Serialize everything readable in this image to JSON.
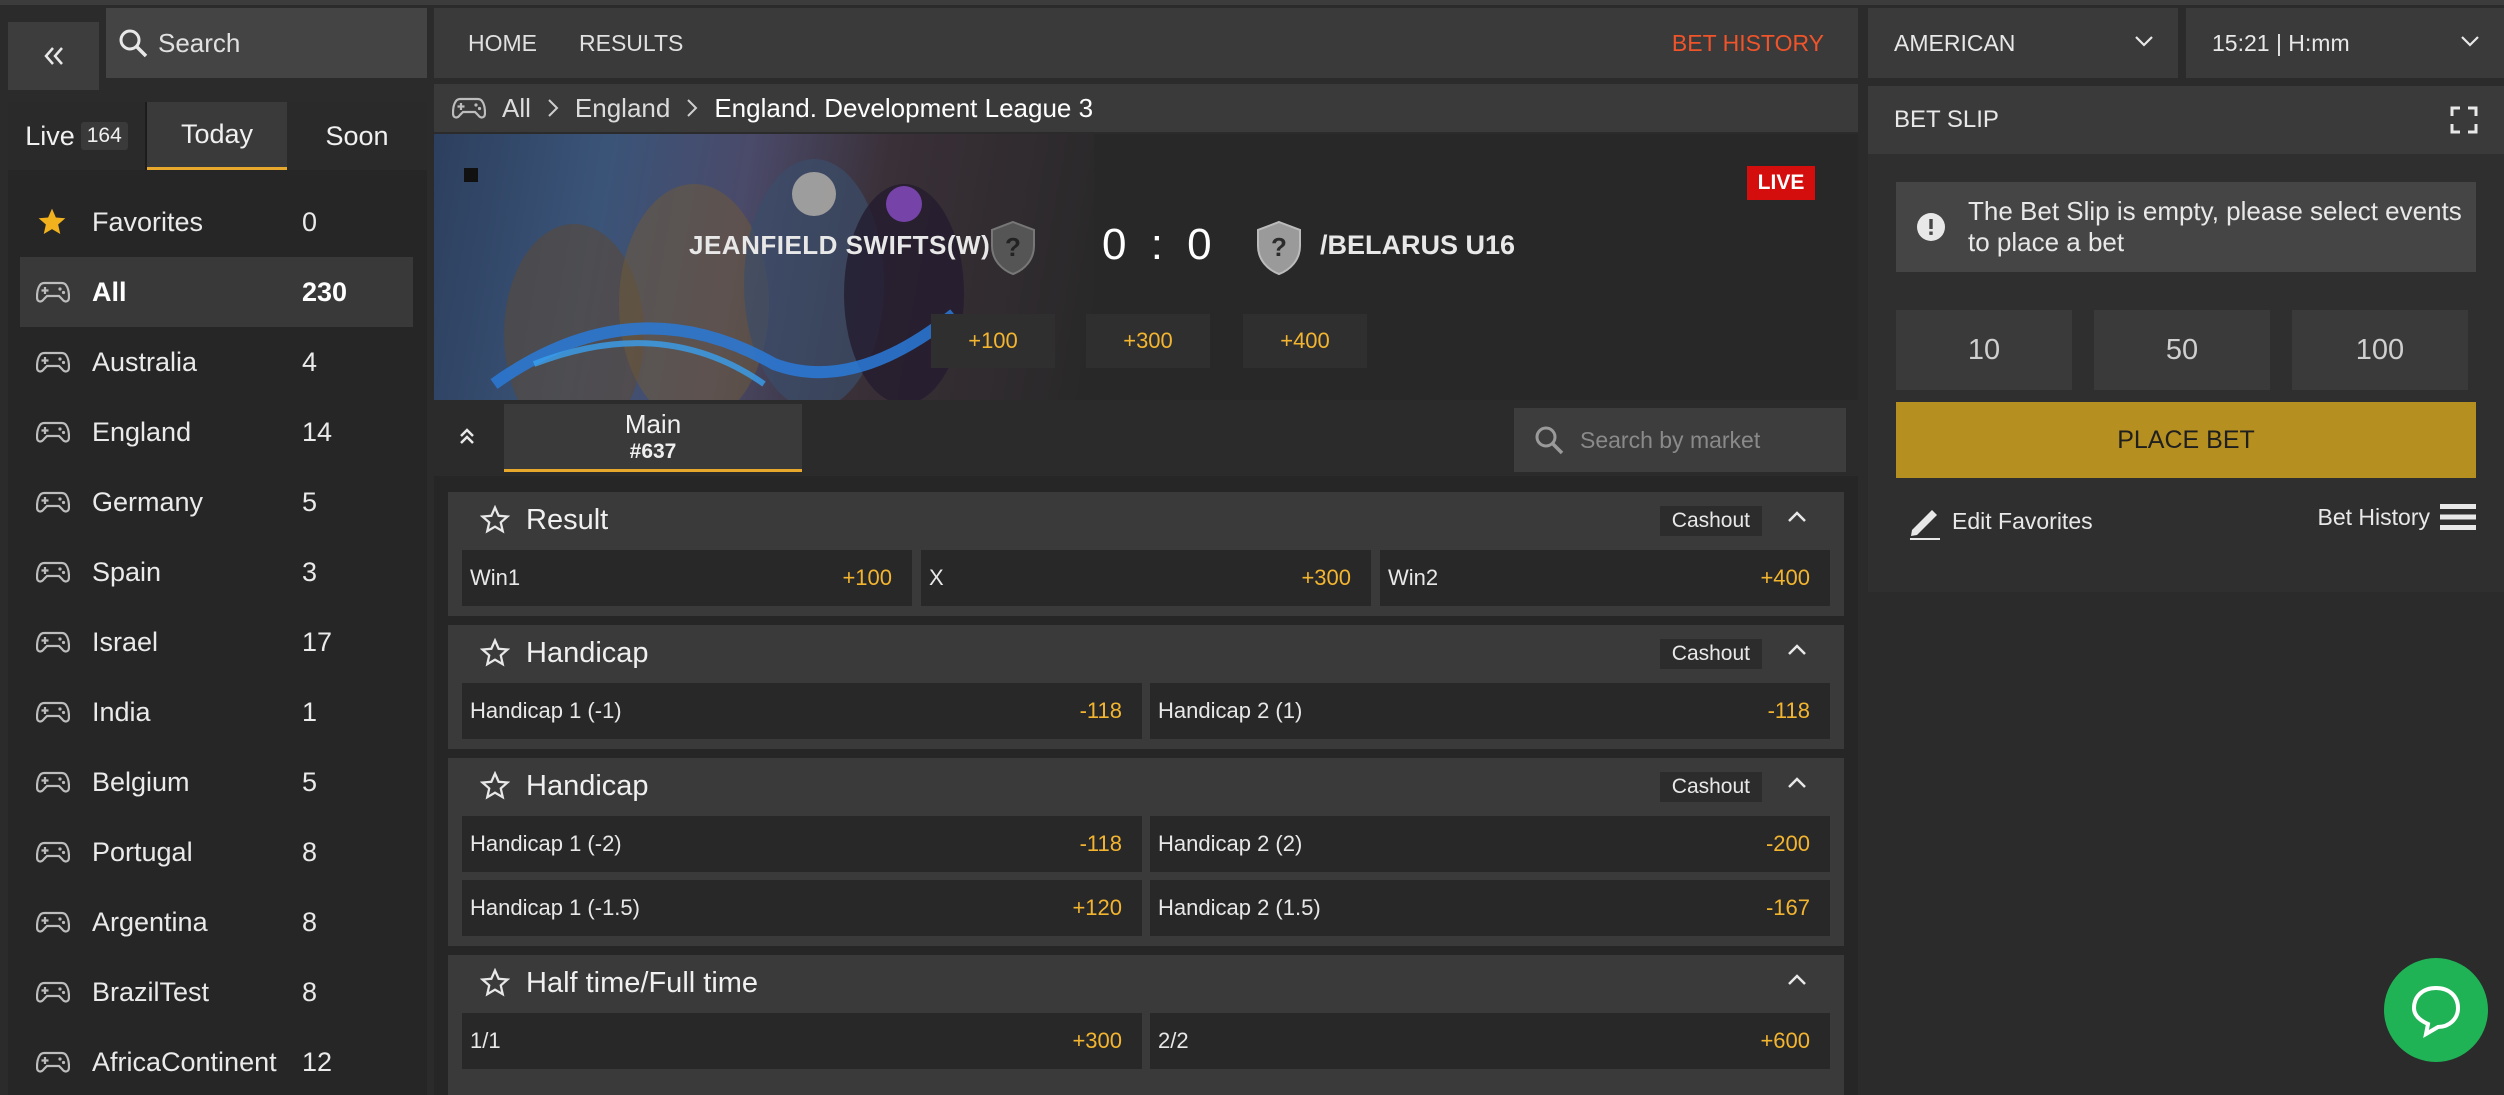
{
  "search": {
    "label": "Search"
  },
  "tabs": {
    "live": "Live",
    "live_count": "164",
    "today": "Today",
    "soon": "Soon"
  },
  "sidebar": {
    "items": [
      {
        "name": "Favorites",
        "count": "0",
        "icon": "star-icon"
      },
      {
        "name": "All",
        "count": "230",
        "icon": "gamepad-icon"
      },
      {
        "name": "Australia",
        "count": "4",
        "icon": "gamepad-icon"
      },
      {
        "name": "England",
        "count": "14",
        "icon": "gamepad-icon"
      },
      {
        "name": "Germany",
        "count": "5",
        "icon": "gamepad-icon"
      },
      {
        "name": "Spain",
        "count": "3",
        "icon": "gamepad-icon"
      },
      {
        "name": "Israel",
        "count": "17",
        "icon": "gamepad-icon"
      },
      {
        "name": "India",
        "count": "1",
        "icon": "gamepad-icon"
      },
      {
        "name": "Belgium",
        "count": "5",
        "icon": "gamepad-icon"
      },
      {
        "name": "Portugal",
        "count": "8",
        "icon": "gamepad-icon"
      },
      {
        "name": "Argentina",
        "count": "8",
        "icon": "gamepad-icon"
      },
      {
        "name": "BrazilTest",
        "count": "8",
        "icon": "gamepad-icon"
      },
      {
        "name": "AfricaContinent",
        "count": "12",
        "icon": "gamepad-icon"
      }
    ]
  },
  "nav": {
    "home": "HOME",
    "results": "RESULTS",
    "bet_history": "BET HISTORY"
  },
  "breadcrumb": {
    "all": "All",
    "country": "England",
    "league": "England. Development League 3"
  },
  "event": {
    "team1": "JEANFIELD SWIFTS(W)",
    "team2": "/BELARUS U16",
    "score": "0 : 0",
    "live": "LIVE",
    "odds": [
      "+100",
      "+300",
      "+400"
    ]
  },
  "market_tab": {
    "label": "Main",
    "sub": "#637"
  },
  "market_search": {
    "placeholder": "Search by market"
  },
  "markets": {
    "result": {
      "title": "Result",
      "cashout": "Cashout",
      "odds": [
        {
          "label": "Win1",
          "value": "+100"
        },
        {
          "label": "X",
          "value": "+300"
        },
        {
          "label": "Win2",
          "value": "+400"
        }
      ]
    },
    "handicap1": {
      "title": "Handicap",
      "cashout": "Cashout",
      "odds": [
        {
          "label": "Handicap 1 (-1)",
          "value": "-118"
        },
        {
          "label": "Handicap 2 (1)",
          "value": "-118"
        }
      ]
    },
    "handicap2": {
      "title": "Handicap",
      "cashout": "Cashout",
      "odds": [
        {
          "label": "Handicap 1 (-2)",
          "value": "-118"
        },
        {
          "label": "Handicap 2 (2)",
          "value": "-200"
        },
        {
          "label": "Handicap 1 (-1.5)",
          "value": "+120"
        },
        {
          "label": "Handicap 2 (1.5)",
          "value": "-167"
        }
      ]
    },
    "htft": {
      "title": "Half time/Full time",
      "odds": [
        {
          "label": "1/1",
          "value": "+300"
        },
        {
          "label": "2/2",
          "value": "+600"
        }
      ]
    }
  },
  "odds_format": "AMERICAN",
  "time_format": "15:21 | H:mm",
  "betslip": {
    "title": "BET SLIP",
    "empty_msg": "The Bet Slip is empty, please select events to place a bet",
    "stakes": [
      "10",
      "50",
      "100"
    ],
    "place_bet": "PLACE BET",
    "edit_favorites": "Edit Favorites",
    "bet_history": "Bet History"
  },
  "colors": {
    "accent": "#e8a82c",
    "odds": "#f3b530",
    "bet_history": "#f0542a",
    "live": "#d40d0d",
    "place_bet": "#b58f1f",
    "chat": "#1fb356"
  }
}
